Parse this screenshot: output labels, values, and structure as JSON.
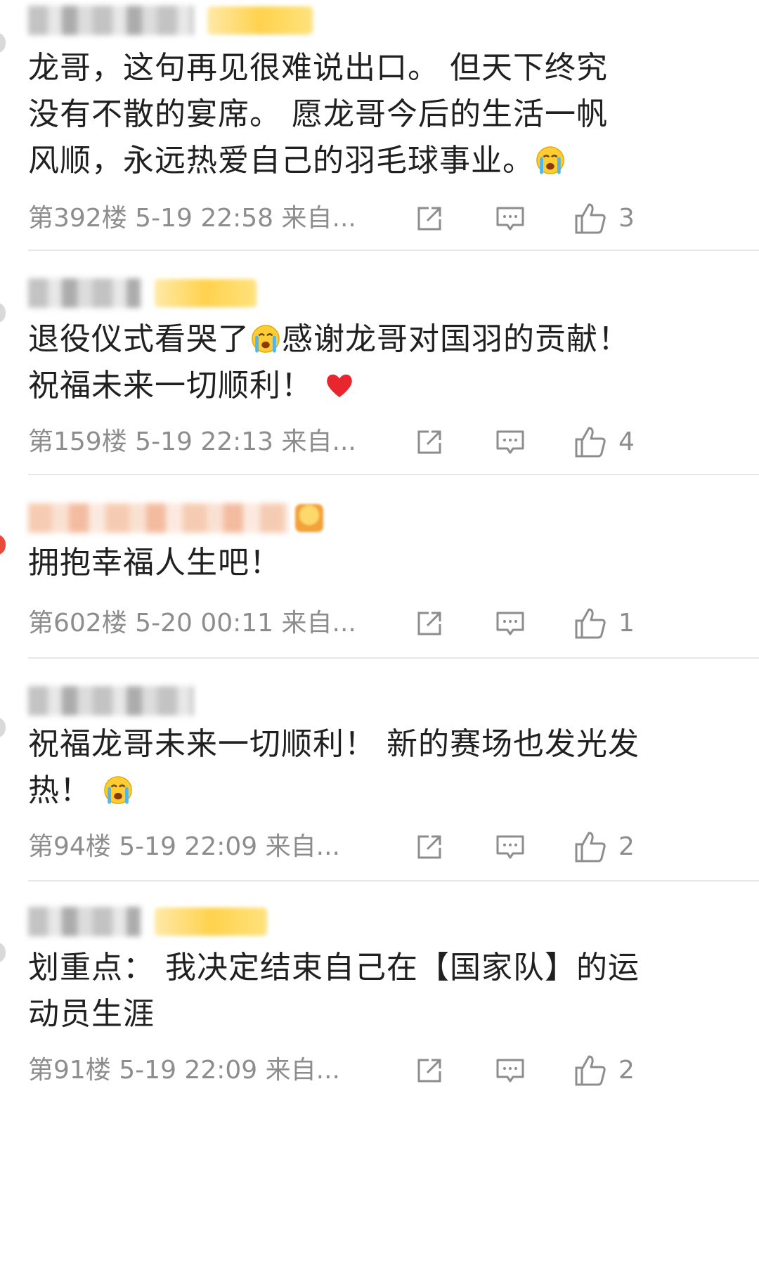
{
  "comments": [
    {
      "text_lines": [
        "龙哥，这句再见很难说出口。 但天下终究",
        "没有不散的宴席。 愿龙哥今后的生活一帆",
        "风顺，永远热爱自己的羽毛球事业。"
      ],
      "emoji_after": "crying-face",
      "floor": "第392楼",
      "time": "5-19 22:58",
      "source": "来自...",
      "likes": "3"
    },
    {
      "text_lines": [
        "退役仪式看哭了",
        "感谢龙哥对国羽的贡献！",
        "祝福未来一切顺利！"
      ],
      "floor": "第159楼",
      "time": "5-19 22:13",
      "source": "来自...",
      "likes": "4"
    },
    {
      "text_lines": [
        "拥抱幸福人生吧！"
      ],
      "floor": "第602楼",
      "time": "5-20 00:11",
      "source": "来自...",
      "likes": "1"
    },
    {
      "text_lines": [
        "祝福龙哥未来一切顺利！ 新的赛场也发光发",
        "热！"
      ],
      "floor": "第94楼",
      "time": "5-19 22:09",
      "source": "来自...",
      "likes": "2"
    },
    {
      "text_lines": [
        "划重点： 我决定结束自己在【国家队】的运",
        "动员生涯"
      ],
      "floor": "第91楼",
      "time": "5-19 22:09",
      "source": "来自...",
      "likes": "2"
    }
  ],
  "icons": {
    "share": "share-icon",
    "reply": "comment-icon",
    "like": "thumbs-up-icon"
  },
  "colors": {
    "text": "#202020",
    "meta": "#8d8d8d",
    "divider": "#e8e8e8"
  }
}
